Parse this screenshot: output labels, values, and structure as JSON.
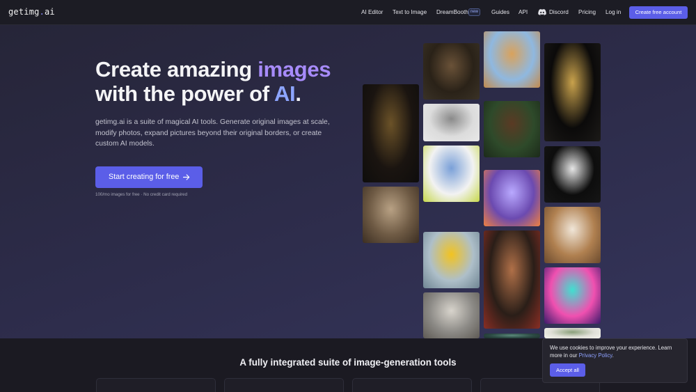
{
  "nav": {
    "logo_text": "getimg",
    "logo_dot": ".",
    "logo_suffix": "ai",
    "links": {
      "ai_editor": "AI Editor",
      "text_to_image": "Text to Image",
      "dreambooth": "DreamBooth",
      "dreambooth_badge": "new",
      "guides": "Guides",
      "api": "API",
      "discord": "Discord",
      "pricing": "Pricing",
      "login": "Log in"
    },
    "create_account_label": "Create free account"
  },
  "hero": {
    "headline_part1": "Create amazing ",
    "headline_accent1": "images",
    "headline_part2": "with the power of ",
    "headline_accent2": "AI",
    "headline_period": ".",
    "description": "getimg.ai is a suite of magical AI tools. Generate original images at scale, modify photos, expand pictures beyond their original borders, or create custom AI models.",
    "cta_label": "Start creating for free",
    "cta_note": "100/mo images for free · No credit card required"
  },
  "gallery": {
    "tiles": [
      {
        "subject": "golden-mask-sculpture",
        "colors": [
          "#1a1410",
          "#6b5228",
          "#0e0d0c"
        ]
      },
      {
        "subject": "bedroom-interior",
        "colors": [
          "#6e5a44",
          "#b8a184",
          "#3b2e22"
        ]
      },
      {
        "subject": "bearded-man-portrait",
        "colors": [
          "#2a2218",
          "#6a5238",
          "#3a3226"
        ]
      },
      {
        "subject": "white-organic-structure",
        "colors": [
          "#dcdcdc",
          "#8a8a8a",
          "#e8e8e8"
        ]
      },
      {
        "subject": "pink-hair-puffer-jacket",
        "colors": [
          "#f2f2f2",
          "#7aa0d8",
          "#c6d84a"
        ]
      },
      {
        "subject": "pikachu-figure",
        "colors": [
          "#aebfc9",
          "#f2c320",
          "#6f8593"
        ]
      },
      {
        "subject": "arched-window-room",
        "colors": [
          "#8c8a86",
          "#d8d4cc",
          "#5e5a54"
        ]
      },
      {
        "subject": "dog-with-sunglasses-beach",
        "colors": [
          "#8fb8e0",
          "#d9a25c",
          "#c48a4c"
        ]
      },
      {
        "subject": "smiling-man-portrait",
        "colors": [
          "#2e4a2a",
          "#5a3a24",
          "#1c2a1a"
        ]
      },
      {
        "subject": "fluffy-cat-galaxy",
        "colors": [
          "#6b4ab0",
          "#b9a9ff",
          "#f08040"
        ]
      },
      {
        "subject": "woman-in-red-robe",
        "colors": [
          "#2a1e18",
          "#b07048",
          "#8a2e24"
        ]
      },
      {
        "subject": "teal-partial-tile",
        "colors": [
          "#2c4a44",
          "#5c8a7c",
          "#1c2e2a"
        ]
      },
      {
        "subject": "golden-flower-sculpture",
        "colors": [
          "#0b0a0a",
          "#c9a24c",
          "#1c1a18"
        ]
      },
      {
        "subject": "white-sneaker",
        "colors": [
          "#0d0d0d",
          "#e6e6e6",
          "#161616"
        ]
      },
      {
        "subject": "cat-with-crown-cafe",
        "colors": [
          "#b08050",
          "#f0e6d8",
          "#6a4a2e"
        ]
      },
      {
        "subject": "neon-sports-car",
        "colors": [
          "#f050b0",
          "#40e0d0",
          "#3a1a6a"
        ]
      },
      {
        "subject": "flowers-partial-tile",
        "colors": [
          "#e0e0d8",
          "#8aa07a",
          "#f4f4ee"
        ]
      }
    ]
  },
  "suite": {
    "title": "A fully integrated suite of image-generation tools"
  },
  "cookie": {
    "text_before": "We use cookies to improve your experience. Learn more in our ",
    "link": "Privacy Policy",
    "text_after": ".",
    "accept_label": "Accept all"
  },
  "colors": {
    "accent": "#5b5ee8",
    "headline_accent_images": "#a78bfa",
    "headline_accent_ai": "#8da5ff",
    "background": "#1c1b24"
  }
}
